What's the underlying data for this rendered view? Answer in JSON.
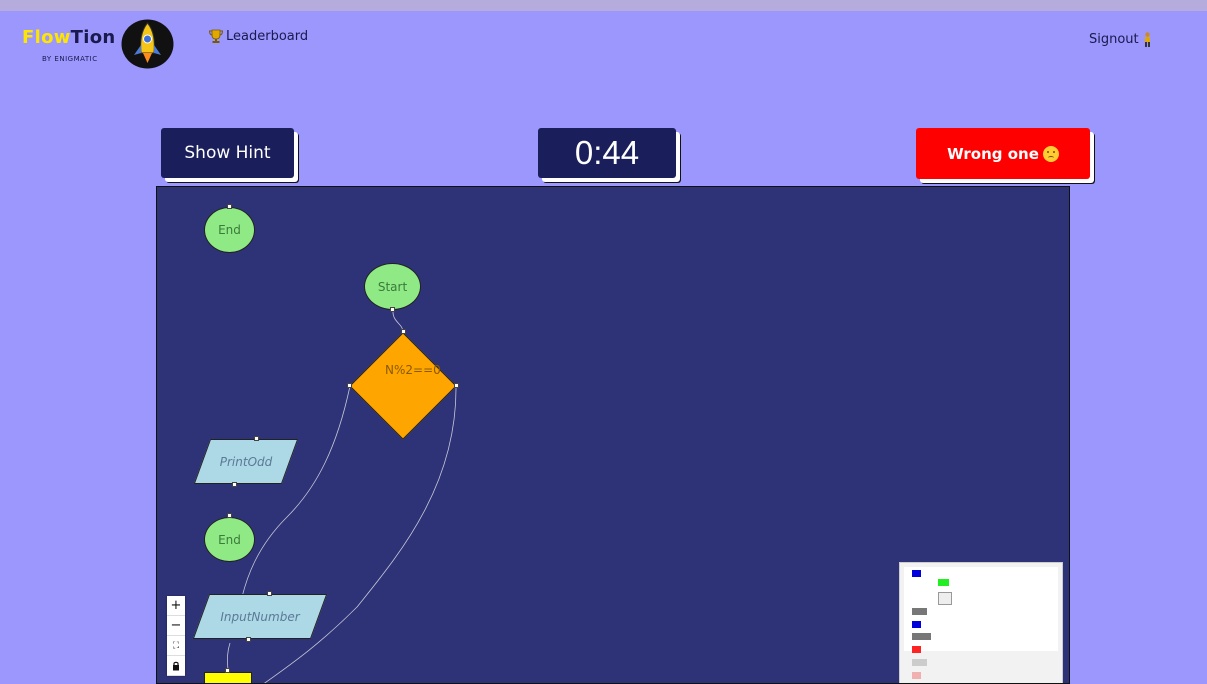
{
  "header": {
    "brand_part1": "Flow",
    "brand_part2": "Tion",
    "brand_subtitle": "BY ENIGMATIC",
    "leaderboard_label": "Leaderboard",
    "signout_label": "Signout"
  },
  "actions": {
    "hint_label": "Show Hint",
    "timer": "0:44",
    "result_label": "Wrong one"
  },
  "flowchart": {
    "nodes": {
      "end_top": "End",
      "start": "Start",
      "decision": "N%2==0",
      "print_odd": "PrintOdd",
      "end_mid": "End",
      "input_number": "InputNumber"
    }
  },
  "controls": {
    "zoom_in": "+",
    "zoom_out": "−",
    "fit_view": "⛶",
    "lock": "🔒"
  },
  "colors": {
    "background": "#9b97fd",
    "canvas": "#2e3377",
    "accent_dark": "#1a1f5c",
    "error": "#ff0000",
    "terminal_node": "#8fea86",
    "decision_node": "#ffa500",
    "io_node": "#add8e6",
    "process_node": "#ffff00"
  },
  "icons": {
    "leaderboard": "trophy-icon",
    "signout": "person-icon",
    "result": "sad-face-icon",
    "logo": "rocket-logo"
  }
}
